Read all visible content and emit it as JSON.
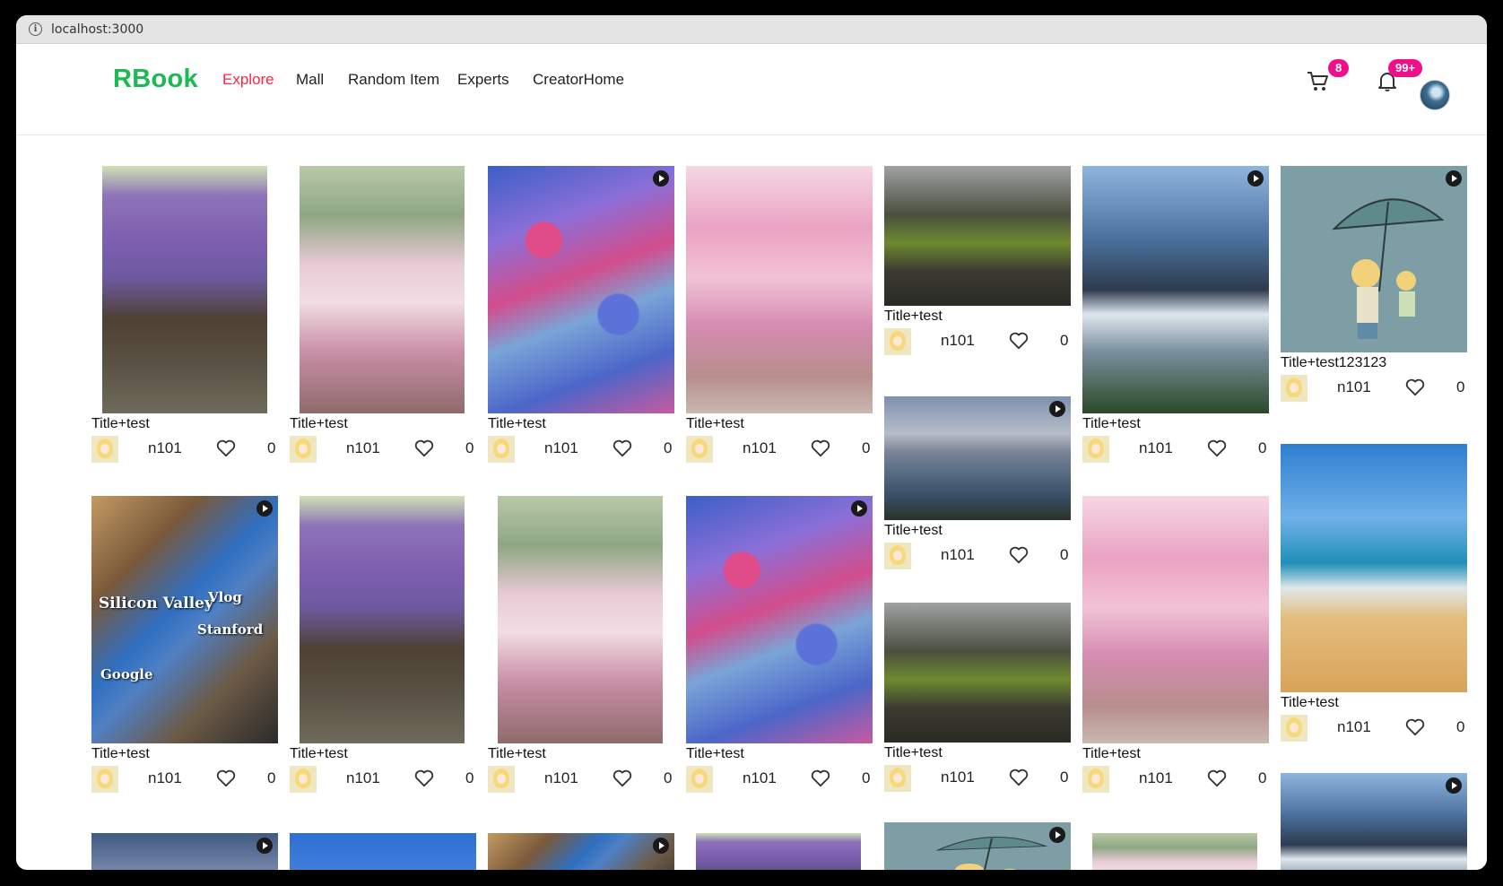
{
  "browser": {
    "url": "localhost:3000"
  },
  "header": {
    "logo": "RBook",
    "nav": [
      "Explore",
      "Mall",
      "Random Item",
      "Experts",
      "CreatorHome"
    ],
    "active_nav": "Explore",
    "cart_badge": "8",
    "notification_badge": "99+"
  },
  "colors": {
    "brand": "#1db954",
    "active": "#ff2442",
    "badge": "#ee0f8a"
  },
  "feed": {
    "cards": [
      {
        "title": "Title+test",
        "author": "n101",
        "likes": "0",
        "image": "wisteria-pavilion",
        "video": false
      },
      {
        "title": "Title+test",
        "author": "n101",
        "likes": "0",
        "image": "hanfu-girl-cherry-blossoms",
        "video": false
      },
      {
        "title": "Title+test",
        "author": "n101",
        "likes": "0",
        "image": "hydrangea-garden",
        "video": true
      },
      {
        "title": "Title+test",
        "author": "n101",
        "likes": "0",
        "image": "cherry-blossoms",
        "video": false
      },
      {
        "title": "Title+test",
        "author": "n101",
        "likes": "0",
        "image": "cliff-pavilion",
        "video": false
      },
      {
        "title": "Title+test",
        "author": "n101",
        "likes": "0",
        "image": "waterfall-ferris-wheel",
        "video": true
      },
      {
        "title": "Title+test123123",
        "author": "n101",
        "likes": "0",
        "image": "cartoon-umbrella",
        "video": true
      },
      {
        "title": "Title+test",
        "author": "n101",
        "likes": "0",
        "image": "lake-mountains",
        "video": true
      },
      {
        "title": "Title+test",
        "author": "n101",
        "likes": "0",
        "image": "beach-mother-child",
        "video": false
      },
      {
        "title": "Title+test",
        "author": "n101",
        "likes": "0",
        "image": "silicon-valley-vlog",
        "video": true,
        "overlay_texts": [
          "Silicon Valley",
          "Vlog",
          "Stanford",
          "Google"
        ]
      },
      {
        "title": "Title+test",
        "author": "n101",
        "likes": "0",
        "image": "wisteria-pavilion",
        "video": false
      },
      {
        "title": "Title+test",
        "author": "n101",
        "likes": "0",
        "image": "hanfu-girl-cherry-blossoms",
        "video": false
      },
      {
        "title": "Title+test",
        "author": "n101",
        "likes": "0",
        "image": "hydrangea-garden",
        "video": true
      },
      {
        "title": "Title+test",
        "author": "n101",
        "likes": "0",
        "image": "cliff-pavilion",
        "video": false
      },
      {
        "title": "Title+test",
        "author": "n101",
        "likes": "0",
        "image": "cherry-blossoms",
        "video": false
      },
      {
        "title": "",
        "author": "",
        "likes": "",
        "image": "waterfall-ferris-wheel",
        "video": true
      },
      {
        "title": "",
        "author": "",
        "likes": "",
        "image": "dusk-mountains",
        "video": true
      },
      {
        "title": "",
        "author": "",
        "likes": "",
        "image": "blue-sky",
        "video": false
      },
      {
        "title": "",
        "author": "",
        "likes": "",
        "image": "silicon-valley-vlog",
        "video": true
      },
      {
        "title": "",
        "author": "",
        "likes": "",
        "image": "wisteria-pavilion",
        "video": false
      },
      {
        "title": "",
        "author": "",
        "likes": "",
        "image": "cartoon-umbrella",
        "video": true
      },
      {
        "title": "",
        "author": "",
        "likes": "",
        "image": "hanfu-girl-cherry-blossoms",
        "video": false
      }
    ]
  }
}
